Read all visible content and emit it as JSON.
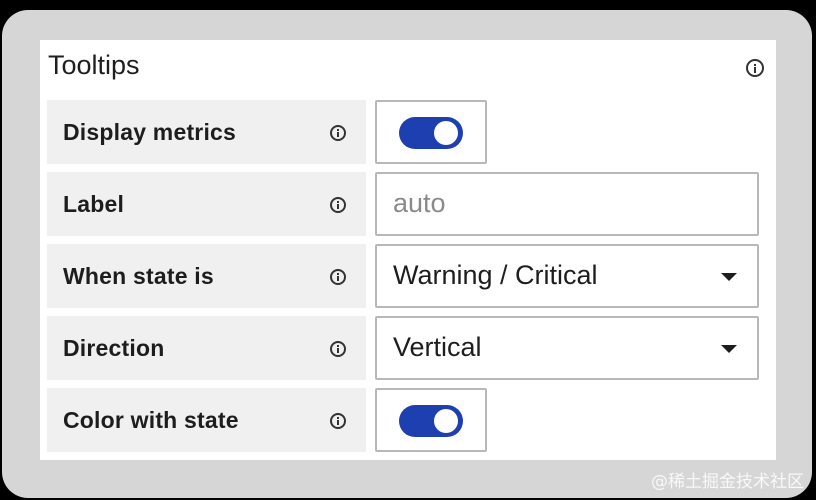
{
  "panel": {
    "title": "Tooltips",
    "title_info_icon": "info-circle-icon"
  },
  "rows": [
    {
      "label": "Display metrics",
      "info_icon": "info-circle-icon",
      "control": "toggle",
      "on": true
    },
    {
      "label": "Label",
      "info_icon": "info-circle-icon",
      "control": "input",
      "placeholder": "auto",
      "value": ""
    },
    {
      "label": "When state is",
      "info_icon": "info-circle-icon",
      "control": "select",
      "value": "Warning / Critical"
    },
    {
      "label": "Direction",
      "info_icon": "info-circle-icon",
      "control": "select",
      "value": "Vertical"
    },
    {
      "label": "Color with state",
      "info_icon": "info-circle-icon",
      "control": "toggle",
      "on": true
    }
  ],
  "watermark": "@稀土掘金技术社区",
  "colors": {
    "toggle_on": "#1d3fb0",
    "panel_bg": "#ffffff",
    "label_bg": "#f0f0f0",
    "frame_bg": "#d6d6d6"
  }
}
